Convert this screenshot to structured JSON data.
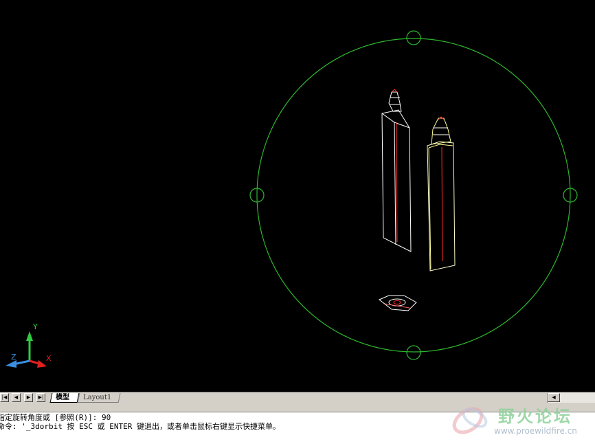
{
  "viewport": {
    "background": "#000000",
    "orbit_color": "#2eb82e",
    "ucs_axes": {
      "y_label": "Y",
      "z_label": "Z",
      "x_label": "X"
    }
  },
  "tabs": {
    "nav_first": "|◀",
    "nav_prev": "◀",
    "nav_next": "▶",
    "nav_last": "▶|",
    "model": "模型",
    "layout1": "Layout1"
  },
  "scrollbar": {
    "left_arrow": "◀"
  },
  "command": {
    "line1": "指定旋转角度或 [参照(R)]: 90",
    "line2": "命令: '_3dorbit 按 ESC 或 ENTER 键退出，或者单击鼠标右键显示快捷菜单。"
  },
  "watermark": {
    "title": "野火论坛",
    "url": "www.proewildfire.cn"
  }
}
